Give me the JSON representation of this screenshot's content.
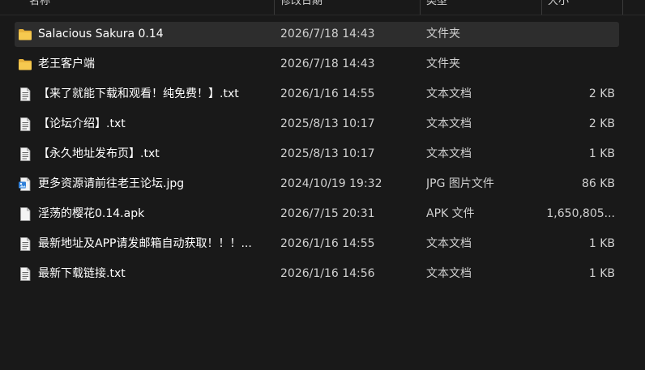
{
  "columns": {
    "name": "名称",
    "date": "修改日期",
    "type": "类型",
    "size": "大小"
  },
  "rows": [
    {
      "name": "Salacious Sakura 0.14",
      "date": "2026/7/18 14:43",
      "type": "文件夹",
      "size": "",
      "icon": "folder-icon"
    },
    {
      "name": "老王客户端",
      "date": "2026/7/18 14:43",
      "type": "文件夹",
      "size": "",
      "icon": "folder-icon"
    },
    {
      "name": "【来了就能下载和观看！纯免费！】.txt",
      "date": "2026/1/16 14:55",
      "type": "文本文档",
      "size": "2 KB",
      "icon": "text-file-icon"
    },
    {
      "name": "【论坛介绍】.txt",
      "date": "2025/8/13 10:17",
      "type": "文本文档",
      "size": "2 KB",
      "icon": "text-file-icon"
    },
    {
      "name": "【永久地址发布页】.txt",
      "date": "2025/8/13 10:17",
      "type": "文本文档",
      "size": "1 KB",
      "icon": "text-file-icon"
    },
    {
      "name": "更多资源请前往老王论坛.jpg",
      "date": "2024/10/19 19:32",
      "type": "JPG 图片文件",
      "size": "86 KB",
      "icon": "image-file-icon"
    },
    {
      "name": "淫荡的樱花0.14.apk",
      "date": "2026/7/15 20:31",
      "type": "APK 文件",
      "size": "1,650,805...",
      "icon": "blank-file-icon"
    },
    {
      "name": "最新地址及APP请发邮箱自动获取！！！...",
      "date": "2026/1/16 14:55",
      "type": "文本文档",
      "size": "1 KB",
      "icon": "text-file-icon"
    },
    {
      "name": "最新下载链接.txt",
      "date": "2026/1/16 14:56",
      "type": "文本文档",
      "size": "1 KB",
      "icon": "text-file-icon"
    }
  ],
  "colors": {
    "background": "#191919",
    "selected_row": "#2d2d2d",
    "folder": "#f4c54a"
  }
}
